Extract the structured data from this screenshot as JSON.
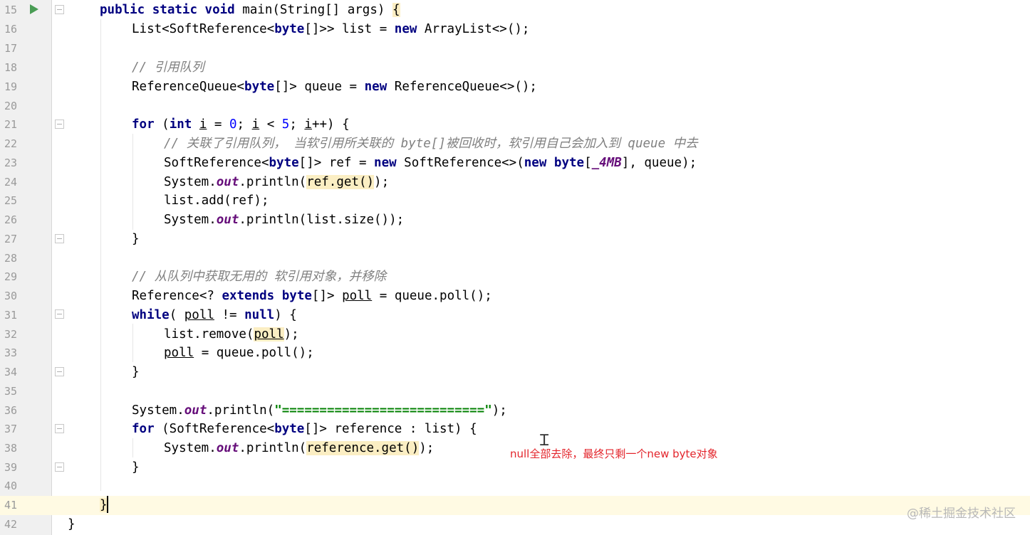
{
  "editor": {
    "lines": [
      {
        "n": "15"
      },
      {
        "n": "16"
      },
      {
        "n": "17"
      },
      {
        "n": "18"
      },
      {
        "n": "19"
      },
      {
        "n": "20"
      },
      {
        "n": "21"
      },
      {
        "n": "22"
      },
      {
        "n": "23"
      },
      {
        "n": "24"
      },
      {
        "n": "25"
      },
      {
        "n": "26"
      },
      {
        "n": "27"
      },
      {
        "n": "28"
      },
      {
        "n": "29"
      },
      {
        "n": "30"
      },
      {
        "n": "31"
      },
      {
        "n": "32"
      },
      {
        "n": "33"
      },
      {
        "n": "34"
      },
      {
        "n": "35"
      },
      {
        "n": "36"
      },
      {
        "n": "37"
      },
      {
        "n": "38"
      },
      {
        "n": "39"
      },
      {
        "n": "40"
      },
      {
        "n": "41"
      },
      {
        "n": "42"
      }
    ],
    "t": {
      "public": "public",
      "static": "static",
      "void": "void",
      "main_sig": " main(String[] args) ",
      "lbrace": "{",
      "rbrace": "}",
      "l16a": "List<SoftReference<",
      "byte": "byte",
      "l16b": "[]>> list = ",
      "new": "new",
      "l16c": " ArrayList<>();",
      "c18": "// 引用队列",
      "l19a": "ReferenceQueue<",
      "l19b": "[]> queue = ",
      "l19c": " ReferenceQueue<>();",
      "for": "for",
      "l21a": " (",
      "int": "int",
      "i": "i",
      "l21b": " = ",
      "zero": "0",
      "l21c": "; ",
      "l21d": " < ",
      "five": "5",
      "l21e": "; ",
      "l21f": "++) {",
      "c22": "// 关联了引用队列， 当软引用所关联的 byte[]被回收时，软引用自己会加入到 queue 中去",
      "l23a": "SoftReference<",
      "l23b": "[]> ref = ",
      "l23c": " SoftReference<>(",
      "l23d": "[",
      "mb": "_4MB",
      "l23e": "], queue);",
      "system": "System.",
      "out": "out",
      "println": ".println(",
      "refget": "ref.get()",
      "l24e": ");",
      "l25": "list.add(ref);",
      "l26b": "list.size());",
      "c29": "// 从队列中获取无用的 软引用对象，并移除",
      "l30a": "Reference<? ",
      "extends": "extends",
      "space": " ",
      "l30b": "[]> ",
      "poll": "poll",
      "l30c": " = queue.poll();",
      "while": "while",
      "l31a": "( ",
      "l31b": " != ",
      "null": "null",
      "l31c": ") {",
      "l32a": "list.remove(",
      "l32c": ");",
      "l33b": " = queue.poll();",
      "l36str": "\"===========================\"",
      "l36e": ");",
      "l37a": " (SoftReference<",
      "l37b": "[]> reference : list) {",
      "refget2": "reference.get()"
    }
  },
  "annotation": "null全部去除，最终只剩一个new byte对象",
  "watermark": "@稀土掘金技术社区",
  "colors": {
    "keyword": "#000080",
    "comment": "#808080",
    "string": "#008000",
    "annotation": "#e3242b"
  }
}
